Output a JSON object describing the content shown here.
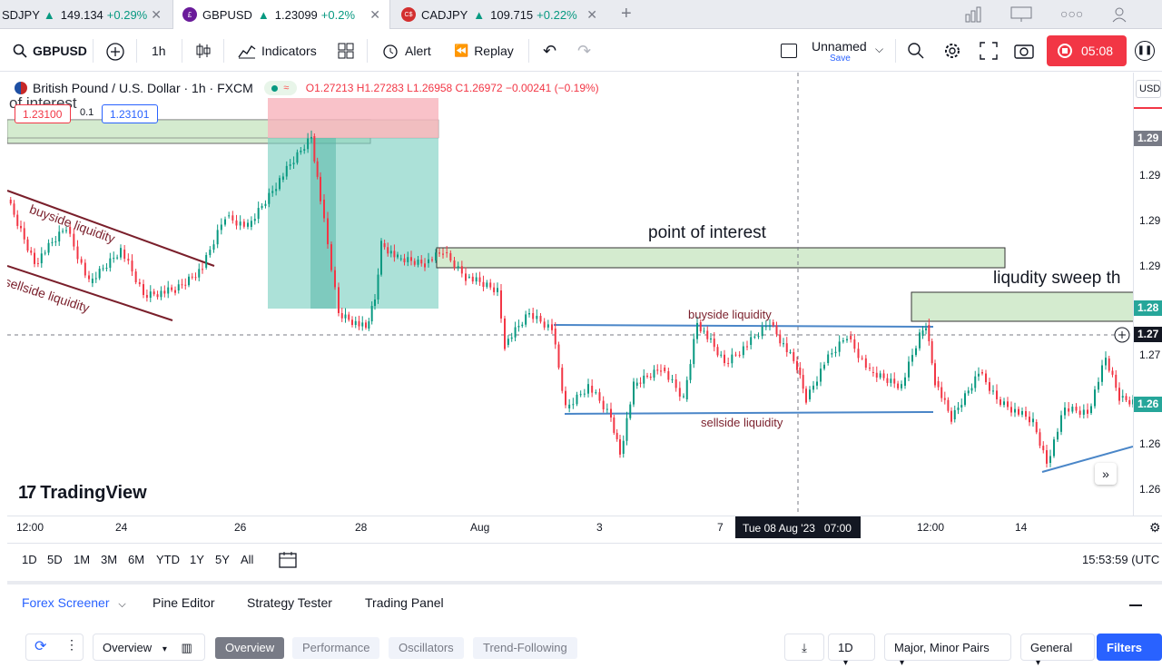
{
  "tabs": [
    {
      "symbol": "SDJPY",
      "arrow": "▲",
      "price": "149.134",
      "change": "+0.29%",
      "coin_color": "#f0a30a",
      "coin_text": ""
    },
    {
      "symbol": "GBPUSD",
      "arrow": "▲",
      "price": "1.23099",
      "change": "+0.2%",
      "coin_color": "#6a1b9a",
      "coin_text": "£"
    },
    {
      "symbol": "CADJPY",
      "arrow": "▲",
      "price": "109.715",
      "change": "+0.22%",
      "coin_color": "#d32f2f",
      "coin_text": "C$"
    }
  ],
  "toolbar": {
    "symbol": "GBPUSD",
    "interval": "1h",
    "indicators": "Indicators",
    "alert": "Alert",
    "replay": "Replay",
    "layout_name": "Unnamed",
    "layout_save": "Save",
    "record_time": "05:08"
  },
  "legend": {
    "title": "British Pound / U.S. Dollar · 1h · FXCM",
    "ohlc": "O1.27213  H1.27283  L1.26958  C1.26972  −0.00241 (−0.19%)",
    "sell_price": "1.23100",
    "spread": "0.1",
    "buy_price": "1.23101",
    "overlap_text": "of interest"
  },
  "annotations": {
    "buyside_left": "buyside liquidity",
    "sellside_left": "sellside liquidity",
    "poi": "point of interest",
    "sweep": "liqudity sweep th",
    "buyside_mid": "buyside liquidity",
    "sellside_mid": "sellside liquidity"
  },
  "watermark": "TradingView",
  "price_axis": {
    "currency": "USD",
    "labels": [
      "1.29",
      "1.29",
      "1.29",
      "1.28",
      "1.27",
      "1.26",
      "1.26"
    ],
    "tags": [
      {
        "text": "1.29",
        "color": "#787b86"
      },
      {
        "text": "1.28",
        "color": "#26a69a"
      },
      {
        "text": "1.27",
        "color": "#131722"
      },
      {
        "text": "1.26",
        "color": "#26a69a"
      }
    ]
  },
  "time_axis": {
    "labels": [
      "12:00",
      "24",
      "26",
      "28",
      "Aug",
      "3",
      "7",
      "12:00",
      "14"
    ],
    "crosshair": "Tue 08 Aug '23   07:00"
  },
  "range_bar": {
    "ranges": [
      "1D",
      "5D",
      "1M",
      "3M",
      "6M",
      "YTD",
      "1Y",
      "5Y",
      "All"
    ],
    "clock": "15:53:59 (UTC"
  },
  "bottom_panel": {
    "tabs": [
      "Forex Screener",
      "Pine Editor",
      "Strategy Tester",
      "Trading Panel"
    ],
    "view": "Overview",
    "chips": [
      "Overview",
      "Performance",
      "Oscillators",
      "Trend-Following"
    ],
    "interval": "1D",
    "pairs": "Major, Minor Pairs",
    "category": "General",
    "filters": "Filters"
  },
  "colors": {
    "up": "#089981",
    "down": "#f23645",
    "zone_fill": "#d4ebcf",
    "accent": "#2962ff",
    "record": "#f23645"
  }
}
